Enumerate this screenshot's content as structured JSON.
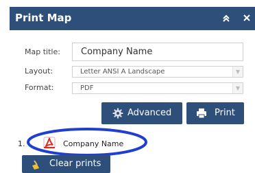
{
  "panel": {
    "title": "Print Map",
    "header_color": "#2d4f79"
  },
  "form": {
    "map_title_label": "Map title:",
    "map_title_value": "Company Name",
    "layout_label": "Layout:",
    "layout_value": "Letter ANSI A Landscape",
    "format_label": "Format:",
    "format_value": "PDF"
  },
  "buttons": {
    "advanced_label": "Advanced",
    "print_label": "Print",
    "clear_label": "Clear prints"
  },
  "results": [
    {
      "number": "1.",
      "icon": "pdf-icon",
      "label": "Company Name"
    }
  ],
  "colors": {
    "accent": "#2d4f79",
    "highlight_ellipse": "#1f3fd0",
    "pdf_red": "#d62c22"
  }
}
